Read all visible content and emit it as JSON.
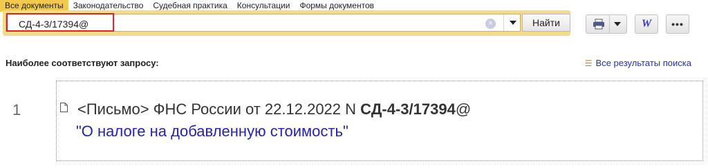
{
  "tabs": [
    {
      "label": "Все документы",
      "active": true
    },
    {
      "label": "Законодательство",
      "active": false
    },
    {
      "label": "Судебная практика",
      "active": false
    },
    {
      "label": "Консультации",
      "active": false
    },
    {
      "label": "Формы документов",
      "active": false
    }
  ],
  "search": {
    "value": "СД-4-3/17394@",
    "button_label": "Найти",
    "clear_symbol": "×"
  },
  "toolbar": {
    "word_label": "W",
    "more_label": "•••"
  },
  "section": {
    "title": "Наиболее соответствуют запросу:",
    "all_results_label": "Все результаты поиска"
  },
  "results": [
    {
      "number": "1",
      "prefix": "<Письмо> ФНС России от 22.12.2022 N ",
      "highlight": "СД-4-3/17394",
      "suffix": "@",
      "title": "\"О налоге на добавленную стоимость\""
    }
  ],
  "colors": {
    "active_tab": "#f2c94c",
    "search_frame": "#f6d98a",
    "highlight_border": "#e3212b",
    "link": "#2233aa",
    "result_title": "#2424a8"
  }
}
